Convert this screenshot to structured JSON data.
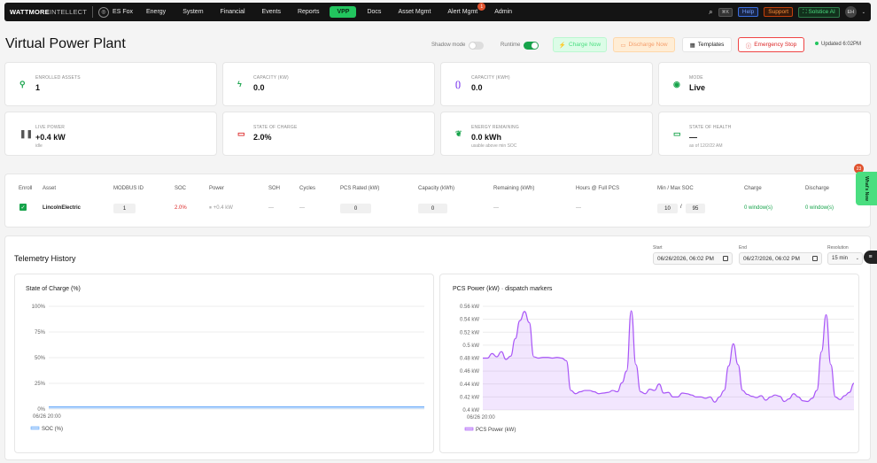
{
  "nav": {
    "logo_a": "WATT",
    "logo_b": "MORE",
    "logo_c": "INTELLECT",
    "org": "ES Fox",
    "items": [
      {
        "label": "Energy",
        "active": false
      },
      {
        "label": "System",
        "active": false
      },
      {
        "label": "Financial",
        "active": false
      },
      {
        "label": "Events",
        "active": false
      },
      {
        "label": "Reports",
        "active": false
      },
      {
        "label": "VPP",
        "active": true
      },
      {
        "label": "Docs",
        "active": false
      },
      {
        "label": "Asset Mgmt",
        "active": false
      },
      {
        "label": "Alert Mgmt",
        "active": false,
        "badge": "1"
      },
      {
        "label": "Admin",
        "active": false
      }
    ],
    "kbd": "⌘K",
    "help": "Help",
    "support": "Support",
    "solstice": "Solstice AI",
    "avatar": "EH"
  },
  "page": {
    "title": "Virtual Power Plant",
    "shadow_mode": "Shadow mode",
    "shadow_mode_on": false,
    "runtime": "Runtime",
    "runtime_on": true,
    "charge_now": "Charge Now",
    "discharge_now": "Discharge Now",
    "templates": "Templates",
    "emergency_stop": "Emergency Stop",
    "updated": "Updated",
    "updated_time": "6:02PM"
  },
  "cards": [
    {
      "label": "Enrolled assets",
      "value": "1",
      "sub": "",
      "icon": "plug-icon",
      "color": "#16a34a"
    },
    {
      "label": "Capacity (kW)",
      "value": "0.0",
      "sub": "",
      "icon": "bolt-icon",
      "color": "#16a34a"
    },
    {
      "label": "Capacity (kWh)",
      "value": "0.0",
      "sub": "",
      "icon": "battery-bracket-icon",
      "color": "#7c3aed"
    },
    {
      "label": "Mode",
      "value": "Live",
      "sub": "",
      "icon": "signal-icon",
      "color": "#16a34a"
    },
    {
      "label": "Live power",
      "value": "+0.4 kW",
      "sub": "idle",
      "icon": "pause-icon",
      "color": "#555555"
    },
    {
      "label": "State of charge",
      "value": "2.0%",
      "sub": "",
      "icon": "battery-low-icon",
      "color": "#dc2626"
    },
    {
      "label": "Energy remaining",
      "value": "0.0 kWh",
      "sub": "usable above min SOC",
      "icon": "leaf-icon",
      "color": "#16a34a"
    },
    {
      "label": "State of health",
      "value": "—",
      "sub": "as of 12/2/22 AM",
      "icon": "monitor-icon",
      "color": "#16a34a"
    }
  ],
  "table": {
    "headers": [
      "Enroll",
      "Asset",
      "MODBUS ID",
      "SOC",
      "Power",
      "SOH",
      "Cycles",
      "PCS Rated (kW)",
      "Capacity (kWh)",
      "Remaining (kWh)",
      "Hours @ Full PCS",
      "Min / Max SOC",
      "Charge",
      "Discharge"
    ],
    "row": {
      "asset": "LincolnElectric",
      "modbus_id": "1",
      "soc": "2.0%",
      "power": "+0.4 kW",
      "soh": "—",
      "cycles": "—",
      "pcs_rated": "0",
      "capacity": "0",
      "remaining": "—",
      "hours": "—",
      "min_soc": "10",
      "slash": "/",
      "max_soc": "95",
      "charge": "0 window(s)",
      "discharge": "0 window(s)"
    }
  },
  "telemetry": {
    "title": "Telemetry History",
    "start_label": "Start",
    "start_value": "06/26/2026, 06:02 PM",
    "end_label": "End",
    "end_value": "06/27/2026, 06:02 PM",
    "resolution_label": "Resolution",
    "resolution_value": "15 min"
  },
  "chart_data": [
    {
      "type": "line",
      "title": "State of Charge (%)",
      "ylim": [
        0,
        100
      ],
      "yticks": [
        "100%",
        "75%",
        "50%",
        "25%",
        "0%"
      ],
      "xticks": [
        "06/26 20:00"
      ],
      "series": [
        {
          "name": "SOC (%)",
          "color": "#60a5fa",
          "values": [
            2,
            2,
            2,
            2,
            2,
            2,
            2,
            2,
            2,
            2
          ]
        }
      ],
      "grid": true,
      "legend": "bottom-left"
    },
    {
      "type": "area",
      "title": "PCS Power (kW) · dispatch markers",
      "ylim": [
        0.4,
        0.56
      ],
      "yticks": [
        "0.56 kW",
        "0.54 kW",
        "0.52 kW",
        "0.5 kW",
        "0.48 kW",
        "0.46 kW",
        "0.44 kW",
        "0.42 kW",
        "0.4 kW"
      ],
      "xticks": [
        "06/26 20:00"
      ],
      "series": [
        {
          "name": "PCS Power (kW)",
          "color": "#a855f7",
          "values": [
            0.48,
            0.48,
            0.487,
            0.482,
            0.49,
            0.478,
            0.483,
            0.51,
            0.538,
            0.552,
            0.535,
            0.482,
            0.48,
            0.481,
            0.481,
            0.48,
            0.481,
            0.48,
            0.476,
            0.43,
            0.425,
            0.428,
            0.43,
            0.43,
            0.428,
            0.425,
            0.426,
            0.427,
            0.43,
            0.428,
            0.442,
            0.46,
            0.553,
            0.47,
            0.428,
            0.425,
            0.432,
            0.43,
            0.44,
            0.426,
            0.427,
            0.42,
            0.42,
            0.426,
            0.425,
            0.423,
            0.42,
            0.42,
            0.418,
            0.42,
            0.412,
            0.42,
            0.43,
            0.468,
            0.502,
            0.47,
            0.43,
            0.424,
            0.421,
            0.419,
            0.422,
            0.415,
            0.42,
            0.423,
            0.421,
            0.413,
            0.417,
            0.425,
            0.42,
            0.414,
            0.413,
            0.418,
            0.43,
            0.49,
            0.547,
            0.47,
            0.42,
            0.416,
            0.422,
            0.427,
            0.441
          ]
        }
      ],
      "grid": true,
      "legend": "bottom-left"
    }
  ],
  "whats_new": "What's New",
  "whats_new_badge": "23"
}
